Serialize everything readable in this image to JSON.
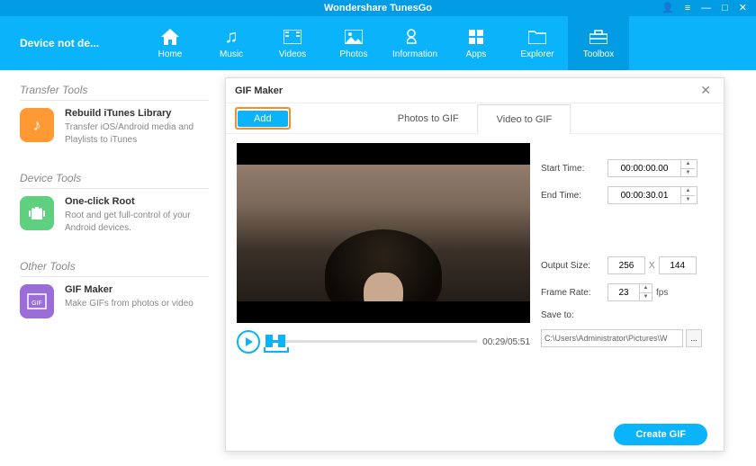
{
  "app": {
    "title": "Wondershare TunesGo"
  },
  "device_status": "Device not de...",
  "nav": [
    {
      "label": "Home",
      "icon": "home"
    },
    {
      "label": "Music",
      "icon": "music"
    },
    {
      "label": "Videos",
      "icon": "video"
    },
    {
      "label": "Photos",
      "icon": "photo"
    },
    {
      "label": "Information",
      "icon": "info"
    },
    {
      "label": "Apps",
      "icon": "apps"
    },
    {
      "label": "Explorer",
      "icon": "folder"
    },
    {
      "label": "Toolbox",
      "icon": "toolbox"
    }
  ],
  "sections": {
    "transfer": {
      "title": "Transfer Tools",
      "items": [
        {
          "title": "Rebuild iTunes Library",
          "desc": "Transfer iOS/Android media and Playlists to iTunes"
        }
      ]
    },
    "device": {
      "title": "Device Tools",
      "items": [
        {
          "title": "One-click Root",
          "desc": "Root and get full-control of your Android devices."
        }
      ]
    },
    "other": {
      "title": "Other Tools",
      "items": [
        {
          "title": "GIF Maker",
          "desc": "Make GIFs from photos or video"
        }
      ]
    }
  },
  "dialog": {
    "title": "GIF Maker",
    "add_label": "Add",
    "tabs": {
      "photos": "Photos to GIF",
      "video": "Video to GIF"
    },
    "time_display": "00:29/05:51",
    "settings": {
      "start_label": "Start Time:",
      "start_value": "00:00:00.00",
      "end_label": "End Time:",
      "end_value": "00:00:30.01",
      "output_label": "Output Size:",
      "width": "256",
      "height": "144",
      "x": "X",
      "frame_label": "Frame Rate:",
      "frame_value": "23",
      "fps": "fps",
      "save_label": "Save to:",
      "save_path": "C:\\Users\\Administrator\\Pictures\\W",
      "browse": "..."
    },
    "create_label": "Create GIF"
  }
}
